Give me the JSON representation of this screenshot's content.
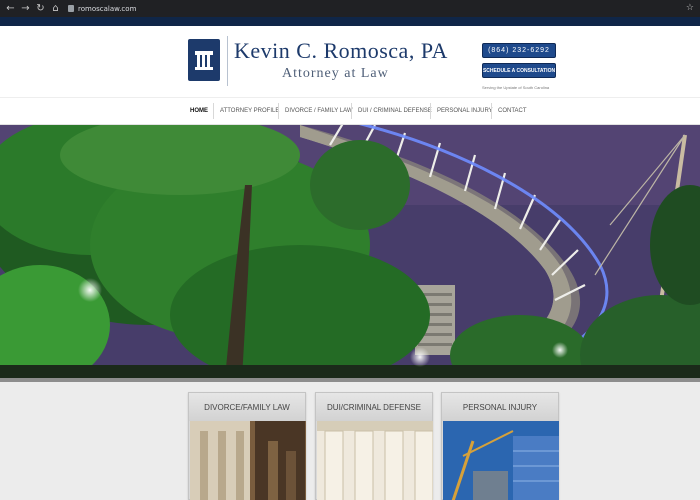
{
  "browser": {
    "url": "romoscalaw.com",
    "icons": [
      "back-icon",
      "forward-icon",
      "reload-icon",
      "home-icon",
      "lock-icon",
      "star-icon"
    ]
  },
  "header": {
    "firm_name": "Kevin C. Romosca, PA",
    "firm_subtitle": "Attorney at Law",
    "phone_button": "(864) 232-6292",
    "consult_button": "SCHEDULE A CONSULTATION",
    "serving_text": "Serving the Upstate of South Carolina"
  },
  "nav": {
    "items": [
      {
        "label": "HOME",
        "active": true
      },
      {
        "label": "ATTORNEY PROFILE",
        "active": false
      },
      {
        "label": "DIVORCE / FAMILY LAW",
        "active": false
      },
      {
        "label": "DUI / CRIMINAL DEFENSE",
        "active": false
      },
      {
        "label": "PERSONAL INJURY",
        "active": false
      },
      {
        "label": "CONTACT",
        "active": false
      }
    ]
  },
  "practice_areas": [
    {
      "title": "DIVORCE/FAMILY LAW"
    },
    {
      "title": "DUI/CRIMINAL DEFENSE"
    },
    {
      "title": "PERSONAL INJURY"
    }
  ],
  "colors": {
    "brand_navy": "#1d3a6b",
    "button_blue": "#1f4a8c",
    "top_bar": "#0f2648"
  }
}
